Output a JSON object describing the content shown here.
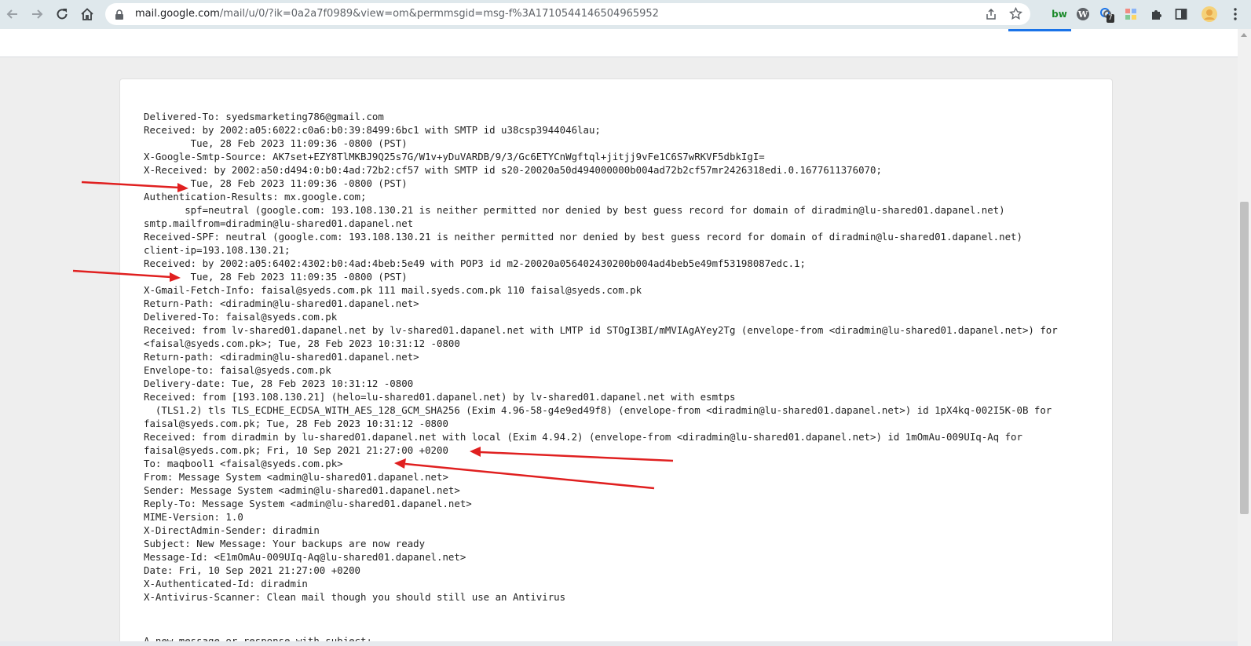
{
  "browser": {
    "url_host": "mail.google.com",
    "url_path": "/mail/u/0/?ik=0a2a7f0989&view=om&permmsgid=msg-f%3A1710544146504965952",
    "extension_badge": "7"
  },
  "icons": {
    "back": "back-arrow-icon",
    "forward": "forward-arrow-icon",
    "reload": "reload-icon",
    "home": "home-icon",
    "lock": "lock-icon",
    "share": "share-icon",
    "star": "star-icon",
    "extensions": "puzzle-icon",
    "sidepanel": "side-panel-icon",
    "profile": "profile-avatar-icon",
    "menu": "kebab-menu-icon"
  },
  "colors": {
    "toolbar": "#dfe8ec",
    "annotation_arrow": "#e02020",
    "text": "#222222"
  },
  "message": {
    "lines": [
      "Delivered-To: syedsmarketing786@gmail.com",
      "Received: by 2002:a05:6022:c0a6:b0:39:8499:6bc1 with SMTP id u38csp3944046lau;",
      "        Tue, 28 Feb 2023 11:09:36 -0800 (PST)",
      "X-Google-Smtp-Source: AK7set+EZY8TlMKBJ9Q25s7G/W1v+yDuVARDB/9/3/Gc6ETYCnWgftql+jitjj9vFe1C6S7wRKVF5dbkIgI=",
      "X-Received: by 2002:a50:d494:0:b0:4ad:72b2:cf57 with SMTP id s20-20020a50d494000000b004ad72b2cf57mr2426318edi.0.1677611376070;",
      "        Tue, 28 Feb 2023 11:09:36 -0800 (PST)",
      "Authentication-Results: mx.google.com;",
      "       spf=neutral (google.com: 193.108.130.21 is neither permitted nor denied by best guess record for domain of diradmin@lu-shared01.dapanel.net)",
      "smtp.mailfrom=diradmin@lu-shared01.dapanel.net",
      "Received-SPF: neutral (google.com: 193.108.130.21 is neither permitted nor denied by best guess record for domain of diradmin@lu-shared01.dapanel.net)",
      "client-ip=193.108.130.21;",
      "Received: by 2002:a05:6402:4302:b0:4ad:4beb:5e49 with POP3 id m2-20020a056402430200b004ad4beb5e49mf53198087edc.1;",
      "        Tue, 28 Feb 2023 11:09:35 -0800 (PST)",
      "X-Gmail-Fetch-Info: faisal@syeds.com.pk 111 mail.syeds.com.pk 110 faisal@syeds.com.pk",
      "Return-Path: <diradmin@lu-shared01.dapanel.net>",
      "Delivered-To: faisal@syeds.com.pk",
      "Received: from lv-shared01.dapanel.net by lv-shared01.dapanel.net with LMTP id STOgI3BI/mMVIAgAYey2Tg (envelope-from <diradmin@lu-shared01.dapanel.net>) for",
      "<faisal@syeds.com.pk>; Tue, 28 Feb 2023 10:31:12 -0800",
      "Return-path: <diradmin@lu-shared01.dapanel.net>",
      "Envelope-to: faisal@syeds.com.pk",
      "Delivery-date: Tue, 28 Feb 2023 10:31:12 -0800",
      "Received: from [193.108.130.21] (helo=lu-shared01.dapanel.net) by lv-shared01.dapanel.net with esmtps",
      "  (TLS1.2) tls TLS_ECDHE_ECDSA_WITH_AES_128_GCM_SHA256 (Exim 4.96-58-g4e9ed49f8) (envelope-from <diradmin@lu-shared01.dapanel.net>) id 1pX4kq-002I5K-0B for",
      "faisal@syeds.com.pk; Tue, 28 Feb 2023 10:31:12 -0800",
      "Received: from diradmin by lu-shared01.dapanel.net with local (Exim 4.94.2) (envelope-from <diradmin@lu-shared01.dapanel.net>) id 1mOmAu-009UIq-Aq for",
      "faisal@syeds.com.pk; Fri, 10 Sep 2021 21:27:00 +0200",
      "To: maqbool1 <faisal@syeds.com.pk>",
      "From: Message System <admin@lu-shared01.dapanel.net>",
      "Sender: Message System <admin@lu-shared01.dapanel.net>",
      "Reply-To: Message System <admin@lu-shared01.dapanel.net>",
      "MIME-Version: 1.0",
      "X-DirectAdmin-Sender: diradmin",
      "Subject: New Message: Your backups are now ready",
      "Message-Id: <E1mOmAu-009UIq-Aq@lu-shared01.dapanel.net>",
      "Date: Fri, 10 Sep 2021 21:27:00 +0200",
      "X-Authenticated-Id: diradmin",
      "X-Antivirus-Scanner: Clean mail though you should still use an Antivirus"
    ],
    "footer_line": "A new message or response with subject:"
  }
}
